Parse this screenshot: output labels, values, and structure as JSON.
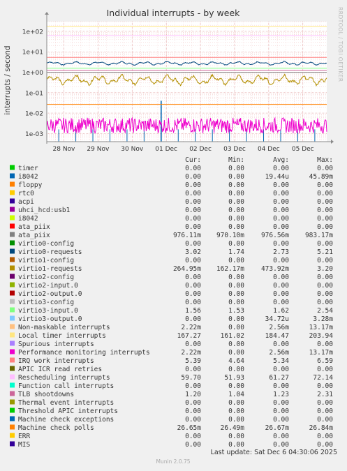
{
  "chart_data": {
    "type": "line",
    "title": "Individual interrupts - by week",
    "ylabel": "interrupts / second",
    "side_label": "RRDTOOL / TOBI OETIKER",
    "footer": "Munin 2.0.75",
    "y_scale": "log",
    "ylim": [
      0.0004,
      300
    ],
    "y_ticks": [
      {
        "v": 100,
        "label": "1e+02"
      },
      {
        "v": 10,
        "label": "1e+01"
      },
      {
        "v": 1,
        "label": "1e+00"
      },
      {
        "v": 0.1,
        "label": "1e-01"
      },
      {
        "v": 0.01,
        "label": "1e-02"
      },
      {
        "v": 0.001,
        "label": "1e-03"
      }
    ],
    "x_ticks": [
      "28 Nov",
      "29 Nov",
      "30 Nov",
      "01 Dec",
      "02 Dec",
      "03 Dec",
      "04 Dec",
      "05 Dec"
    ],
    "x_range_days": [
      0,
      8.2
    ],
    "x_tick_days": [
      0.5,
      1.5,
      2.5,
      3.5,
      4.5,
      5.5,
      6.5,
      7.5
    ],
    "grid": true,
    "legend_headers": {
      "cur": "Cur:",
      "min": "Min:",
      "avg": "Avg:",
      "max": "Max:"
    },
    "series": [
      {
        "name": "timer",
        "color": "#00cc00",
        "cur": "0.00",
        "min": "0.00",
        "avg": "0.00",
        "max": "0.00"
      },
      {
        "name": "i8042",
        "color": "#0066b3",
        "cur": "0.00",
        "min": "0.00",
        "avg": "19.44u",
        "max": "45.89m",
        "draw": "spikes",
        "level": 0.0004,
        "peak": 0.04
      },
      {
        "name": "floppy",
        "color": "#ff8000",
        "cur": "0.00",
        "min": "0.00",
        "avg": "0.00",
        "max": "0.00"
      },
      {
        "name": "rtc0",
        "color": "#ffcc00",
        "cur": "0.00",
        "min": "0.00",
        "avg": "0.00",
        "max": "0.00"
      },
      {
        "name": "acpi",
        "color": "#330099",
        "cur": "0.00",
        "min": "0.00",
        "avg": "0.00",
        "max": "0.00"
      },
      {
        "name": "uhci_hcd:usb1",
        "color": "#990099",
        "cur": "0.00",
        "min": "0.00",
        "avg": "0.00",
        "max": "0.00"
      },
      {
        "name": "i8042",
        "color": "#ccff00",
        "cur": "0.00",
        "min": "0.00",
        "avg": "0.00",
        "max": "0.00"
      },
      {
        "name": "ata_piix",
        "color": "#ff0000",
        "cur": "0.00",
        "min": "0.00",
        "avg": "0.00",
        "max": "0.00"
      },
      {
        "name": "ata_piix",
        "color": "#808080",
        "cur": "976.11m",
        "min": "970.10m",
        "avg": "976.56m",
        "max": "983.17m",
        "draw": "flat",
        "level": 0.976
      },
      {
        "name": "virtio0-config",
        "color": "#008f00",
        "cur": "0.00",
        "min": "0.00",
        "avg": "0.00",
        "max": "0.00"
      },
      {
        "name": "virtio0-requests",
        "color": "#00487d",
        "cur": "3.02",
        "min": "1.74",
        "avg": "2.73",
        "max": "5.21",
        "draw": "wavy",
        "level": 2.73,
        "amp": 0.1
      },
      {
        "name": "virtio1-config",
        "color": "#b35a00",
        "cur": "0.00",
        "min": "0.00",
        "avg": "0.00",
        "max": "0.00"
      },
      {
        "name": "virtio1-requests",
        "color": "#b38f00",
        "cur": "264.95m",
        "min": "162.17m",
        "avg": "473.92m",
        "max": "3.20",
        "draw": "wavy",
        "level": 0.42,
        "amp": 0.28
      },
      {
        "name": "virtio2-config",
        "color": "#6b006b",
        "cur": "0.00",
        "min": "0.00",
        "avg": "0.00",
        "max": "0.00"
      },
      {
        "name": "virtio2-input.0",
        "color": "#8fb300",
        "cur": "0.00",
        "min": "0.00",
        "avg": "0.00",
        "max": "0.00"
      },
      {
        "name": "virtio2-output.0",
        "color": "#b30000",
        "cur": "0.00",
        "min": "0.00",
        "avg": "0.00",
        "max": "0.00"
      },
      {
        "name": "virtio3-config",
        "color": "#bebebe",
        "cur": "0.00",
        "min": "0.00",
        "avg": "0.00",
        "max": "0.00"
      },
      {
        "name": "virtio3-input.0",
        "color": "#80ff80",
        "cur": "1.56",
        "min": "1.53",
        "avg": "1.62",
        "max": "2.54",
        "draw": "flat",
        "level": 1.58
      },
      {
        "name": "virtio3-output.0",
        "color": "#80c9ff",
        "cur": "0.00",
        "min": "0.00",
        "avg": "34.72u",
        "max": "3.28m"
      },
      {
        "name": "Non-maskable interrupts",
        "color": "#ffc080",
        "cur": "2.22m",
        "min": "0.00",
        "avg": "2.56m",
        "max": "13.17m"
      },
      {
        "name": "Local timer interrupts",
        "color": "#ffe680",
        "cur": "167.27",
        "min": "161.02",
        "avg": "184.47",
        "max": "203.94",
        "draw": "flat",
        "level": 175
      },
      {
        "name": "Spurious interrupts",
        "color": "#aa80ff",
        "cur": "0.00",
        "min": "0.00",
        "avg": "0.00",
        "max": "0.00"
      },
      {
        "name": "Performance monitoring interrupts",
        "color": "#ee00cc",
        "cur": "2.22m",
        "min": "0.00",
        "avg": "2.56m",
        "max": "13.17m",
        "draw": "noisy",
        "level": 0.0025,
        "amp": 0.38
      },
      {
        "name": "IRQ work interrupts",
        "color": "#ff8080",
        "cur": "5.39",
        "min": "4.64",
        "avg": "5.34",
        "max": "6.59",
        "draw": "flat",
        "level": 5.3
      },
      {
        "name": "APIC ICR read retries",
        "color": "#666600",
        "cur": "0.00",
        "min": "0.00",
        "avg": "0.00",
        "max": "0.00"
      },
      {
        "name": "Rescheduling interrupts",
        "color": "#ffbfff",
        "cur": "59.70",
        "min": "51.93",
        "avg": "61.27",
        "max": "72.14",
        "draw": "flat",
        "level": 62
      },
      {
        "name": "Function call interrupts",
        "color": "#00ffcc",
        "cur": "0.00",
        "min": "0.00",
        "avg": "0.00",
        "max": "0.00"
      },
      {
        "name": "TLB shootdowns",
        "color": "#cc6699",
        "cur": "1.20",
        "min": "1.04",
        "avg": "1.23",
        "max": "2.31",
        "draw": "flat",
        "level": 1.22
      },
      {
        "name": "Thermal event interrupts",
        "color": "#999900",
        "cur": "0.00",
        "min": "0.00",
        "avg": "0.00",
        "max": "0.00"
      },
      {
        "name": "Threshold APIC interrupts",
        "color": "#00cc00",
        "cur": "0.00",
        "min": "0.00",
        "avg": "0.00",
        "max": "0.00"
      },
      {
        "name": "Machine check exceptions",
        "color": "#0066b3",
        "cur": "0.00",
        "min": "0.00",
        "avg": "0.00",
        "max": "0.00"
      },
      {
        "name": "Machine check polls",
        "color": "#ff8000",
        "cur": "26.65m",
        "min": "26.49m",
        "avg": "26.67m",
        "max": "26.84m",
        "draw": "flat",
        "level": 0.0267
      },
      {
        "name": "ERR",
        "color": "#ffcc00",
        "cur": "0.00",
        "min": "0.00",
        "avg": "0.00",
        "max": "0.00"
      },
      {
        "name": "MIS",
        "color": "#330099",
        "cur": "0.00",
        "min": "0.00",
        "avg": "0.00",
        "max": "0.00"
      }
    ],
    "last_update": "Last update: Sat Dec  6 04:30:06 2025"
  }
}
